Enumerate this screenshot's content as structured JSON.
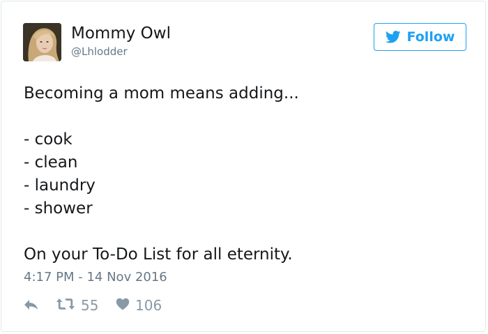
{
  "user": {
    "display_name": "Mommy Owl",
    "handle": "@Lhlodder"
  },
  "follow_button": {
    "label": "Follow",
    "icon": "twitter-bird-icon",
    "accent_color": "#1da1f2"
  },
  "tweet": {
    "lines": [
      "Becoming a mom means adding...",
      "",
      "- cook",
      "- clean",
      "- laundry",
      "- shower",
      "",
      "On your To-Do List for all eternity."
    ],
    "timestamp": "4:17 PM - 14 Nov 2016"
  },
  "actions": {
    "reply_icon": "reply-icon",
    "retweet_icon": "retweet-icon",
    "retweet_count": "55",
    "like_icon": "heart-icon",
    "like_count": "106"
  },
  "colors": {
    "text": "#14171a",
    "secondary_text": "#657786",
    "action_icons": "#8899a6",
    "border": "#e1e8ed"
  }
}
